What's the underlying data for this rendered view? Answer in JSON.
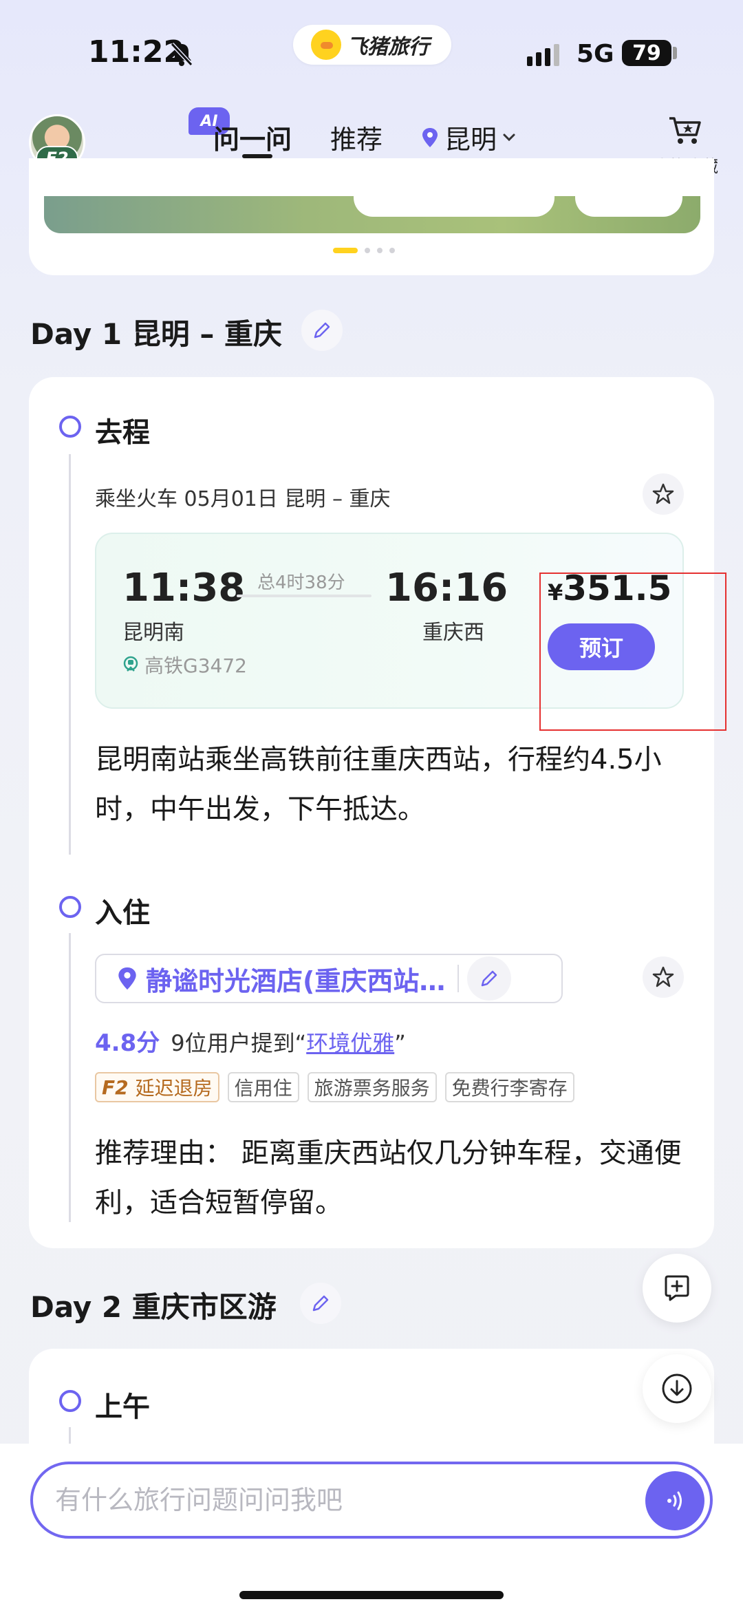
{
  "status_bar": {
    "time": "11:22",
    "network": "5G",
    "battery": "79"
  },
  "app_pill": {
    "name": "飞猪旅行"
  },
  "header": {
    "avatar_badge": "F2",
    "ai_badge": "AI",
    "tabs": [
      {
        "label": "问一问",
        "active": true
      },
      {
        "label": "推荐"
      }
    ],
    "location": "昆明",
    "favorites_label": "我的收藏"
  },
  "days": [
    {
      "title": "Day 1 昆明 – 重庆",
      "sections": [
        {
          "title": "去程",
          "trip_line": "乘坐火车 05月01日 昆明 – 重庆",
          "train": {
            "depart_time": "11:38",
            "depart_station": "昆明南",
            "duration": "总4时38分",
            "arrive_time": "16:16",
            "arrive_station": "重庆西",
            "train_no": "高铁G3472",
            "currency": "¥",
            "price": "351.5",
            "book_label": "预订"
          },
          "description": "昆明南站乘坐高铁前往重庆西站，行程约4.5小时，中午出发，下午抵达。"
        },
        {
          "title": "入住",
          "hotel": {
            "name": "静谧时光酒店(重庆西站…",
            "score": "4.8分",
            "mention_prefix": "9位用户提到“",
            "mention_keyword": "环境优雅",
            "mention_suffix": "”",
            "tags": [
              {
                "badge": "F2",
                "label": "延迟退房"
              },
              {
                "label": "信用住"
              },
              {
                "label": "旅游票务服务"
              },
              {
                "label": "免费行李寄存"
              }
            ],
            "reason": "推荐理由： 距离重庆西站仅几分钟车程，交通便利，适合短暂停留。"
          }
        }
      ]
    },
    {
      "title": "Day 2 重庆市区游",
      "sections": [
        {
          "title": "上午"
        }
      ]
    }
  ],
  "chat_input": {
    "placeholder": "有什么旅行问题问问我吧"
  },
  "colors": {
    "accent": "#6c63f0",
    "brand_yellow": "#ffd21f",
    "highlight_box": "#e53030"
  }
}
